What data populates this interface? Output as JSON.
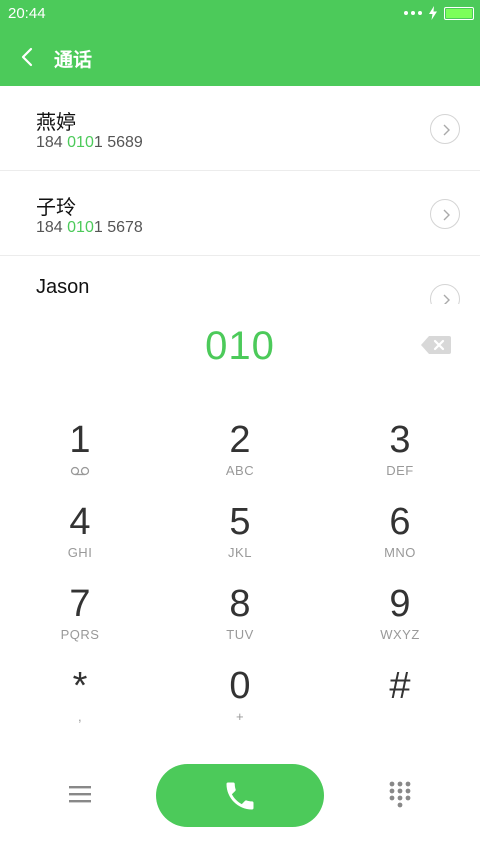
{
  "status_bar": {
    "time": "20:44"
  },
  "app_bar": {
    "title": "通话"
  },
  "contacts": [
    {
      "name": "燕婷",
      "number_prefix": "184 ",
      "number_match": "010",
      "number_suffix": "1 5689"
    },
    {
      "name": "子玲",
      "number_prefix": "184 ",
      "number_match": "010",
      "number_suffix": "1 5678"
    },
    {
      "name": "Jason",
      "number_prefix": "",
      "number_match": "",
      "number_suffix": ""
    }
  ],
  "dial_entry": {
    "digits": "010"
  },
  "keypad": {
    "keys": [
      {
        "digit": "1",
        "letters": ""
      },
      {
        "digit": "2",
        "letters": "ABC"
      },
      {
        "digit": "3",
        "letters": "DEF"
      },
      {
        "digit": "4",
        "letters": "GHI"
      },
      {
        "digit": "5",
        "letters": "JKL"
      },
      {
        "digit": "6",
        "letters": "MNO"
      },
      {
        "digit": "7",
        "letters": "PQRS"
      },
      {
        "digit": "8",
        "letters": "TUV"
      },
      {
        "digit": "9",
        "letters": "WXYZ"
      },
      {
        "digit": "*",
        "letters": ","
      },
      {
        "digit": "0",
        "letters": "+"
      },
      {
        "digit": "#",
        "letters": ""
      }
    ]
  },
  "colors": {
    "accent": "#4cca5a",
    "text": "#333333",
    "muted": "#999999"
  },
  "icons": {
    "back": "chevron-left-icon",
    "row_arrow": "chevron-right-circle-icon",
    "backspace": "backspace-icon",
    "voicemail": "voicemail-icon",
    "menu": "menu-icon",
    "call": "phone-icon",
    "keypad_toggle": "dialpad-grid-icon"
  }
}
